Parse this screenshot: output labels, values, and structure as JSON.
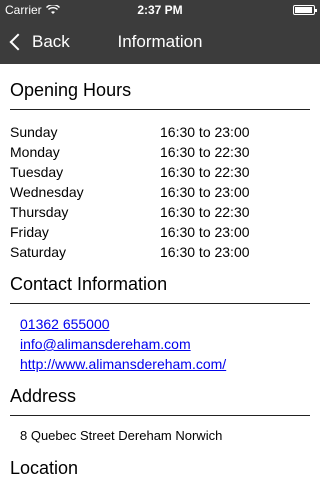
{
  "status": {
    "carrier": "Carrier",
    "time": "2:37 PM",
    "battery_level": 0.95
  },
  "nav": {
    "back_label": "Back",
    "title": "Information"
  },
  "hours": {
    "heading": "Opening Hours",
    "rows": [
      {
        "day": "Sunday",
        "time": "16:30 to 23:00"
      },
      {
        "day": "Monday",
        "time": "16:30 to 22:30"
      },
      {
        "day": "Tuesday",
        "time": "16:30 to 22:30"
      },
      {
        "day": "Wednesday",
        "time": "16:30 to 23:00"
      },
      {
        "day": "Thursday",
        "time": "16:30 to 22:30"
      },
      {
        "day": "Friday",
        "time": "16:30 to 23:00"
      },
      {
        "day": "Saturday",
        "time": "16:30 to 23:00"
      }
    ]
  },
  "contact": {
    "heading": "Contact Information",
    "phone": "01362 655000",
    "email": "info@alimansdereham.com",
    "website": "http://www.alimansdereham.com/"
  },
  "address": {
    "heading": "Address",
    "text": "8 Quebec Street Dereham Norwich"
  },
  "location": {
    "heading": "Location"
  }
}
